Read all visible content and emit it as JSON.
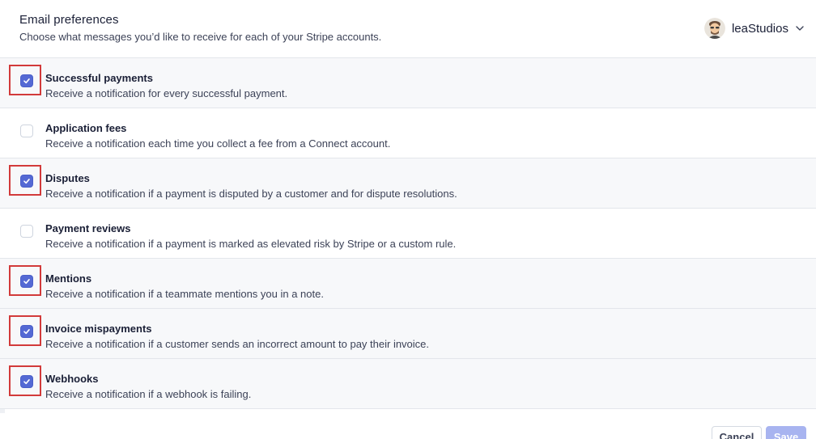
{
  "header": {
    "title": "Email preferences",
    "subtitle": "Choose what messages you’d like to receive for each of your Stripe accounts."
  },
  "account": {
    "name": "leaStudios",
    "avatar_icon": "avatar-icon",
    "dropdown_icon": "chevron-down-icon"
  },
  "preferences": [
    {
      "title": "Successful payments",
      "description": "Receive a notification for every successful payment.",
      "checked": true,
      "highlighted": true
    },
    {
      "title": "Application fees",
      "description": "Receive a notification each time you collect a fee from a Connect account.",
      "checked": false,
      "highlighted": false
    },
    {
      "title": "Disputes",
      "description": "Receive a notification if a payment is disputed by a customer and for dispute resolutions.",
      "checked": true,
      "highlighted": true
    },
    {
      "title": "Payment reviews",
      "description": "Receive a notification if a payment is marked as elevated risk by Stripe or a custom rule.",
      "checked": false,
      "highlighted": false
    },
    {
      "title": "Mentions",
      "description": "Receive a notification if a teammate mentions you in a note.",
      "checked": true,
      "highlighted": true
    },
    {
      "title": "Invoice mispayments",
      "description": "Receive a notification if a customer sends an incorrect amount to pay their invoice.",
      "checked": true,
      "highlighted": true
    },
    {
      "title": "Webhooks",
      "description": "Receive a notification if a webhook is failing.",
      "checked": true,
      "highlighted": true
    }
  ],
  "footer": {
    "cancel_label": "Cancel",
    "save_label": "Save"
  },
  "colors": {
    "accent": "#5469d4",
    "highlight": "#d23a3a",
    "save_disabled": "#a8b4f0"
  }
}
